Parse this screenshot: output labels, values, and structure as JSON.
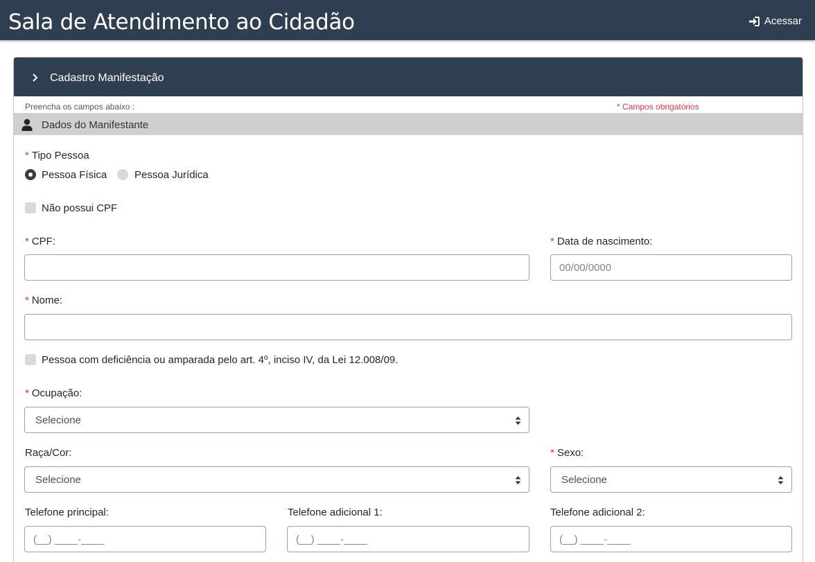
{
  "app": {
    "title": "Sala de Atendimento ao Cidadão",
    "login_label": "Acessar"
  },
  "card": {
    "header_title": "Cadastro Manifestação",
    "hint": "Preencha os campos abaixo :",
    "required_note": "* Campos obrigatórios"
  },
  "section": {
    "title": "Dados do Manifestante"
  },
  "form": {
    "tipo_pessoa": {
      "label": "Tipo Pessoa",
      "options": [
        "Pessoa Física",
        "Pessoa Jurídica"
      ],
      "selected": "Pessoa Física"
    },
    "nao_possui_cpf": "Não possui CPF",
    "cpf": {
      "label": "CPF:",
      "value": ""
    },
    "data_nascimento": {
      "label": "Data de nascimento:",
      "placeholder": "00/00/0000"
    },
    "nome": {
      "label": "Nome:",
      "value": ""
    },
    "deficiencia": "Pessoa com deficiência ou amparada pelo art. 4º, inciso IV, da Lei 12.008/09.",
    "ocupacao": {
      "label": "Ocupação:",
      "value": "Selecione"
    },
    "raca_cor": {
      "label": "Raça/Cor:",
      "value": "Selecione"
    },
    "sexo": {
      "label": "Sexo:",
      "value": "Selecione"
    },
    "telefone_principal": {
      "label": "Telefone principal:",
      "placeholder": "(__) ____-____"
    },
    "telefone_adicional_1": {
      "label": "Telefone adicional 1:",
      "placeholder": "(__) ____-____"
    },
    "telefone_adicional_2": {
      "label": "Telefone adicional 2:",
      "placeholder": "(__) ____-____"
    }
  },
  "colors": {
    "header_bg": "#2f3e51",
    "required": "#dc3545",
    "section_bg": "#cfcfcf"
  },
  "icons": [
    "sign-in-icon",
    "chevron-right-icon",
    "user-icon",
    "sort-icon"
  ]
}
